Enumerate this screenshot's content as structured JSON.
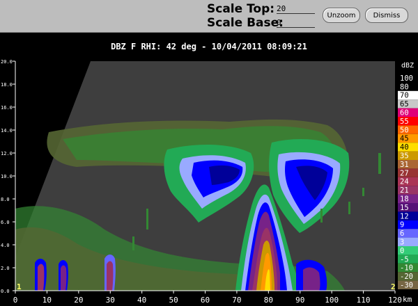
{
  "controls": {
    "scale_top_label": "Scale Top:",
    "scale_top_value": "20",
    "scale_base_label": "Scale Base:",
    "scale_base_value": "0",
    "unzoom_label": "Unzoom",
    "dismiss_label": "Dismiss"
  },
  "plot": {
    "title": "DBZ F  RHI: 42 deg  -  10/04/2011 08:09:21",
    "x_unit": "km",
    "x_ticks": [
      "0",
      "10",
      "20",
      "30",
      "40",
      "50",
      "60",
      "70",
      "80",
      "90",
      "100",
      "110",
      "120"
    ],
    "y_ticks": [
      "0.0",
      "2.0",
      "4.0",
      "6.0",
      "8.0",
      "10.0",
      "12.0",
      "14.0",
      "16.0",
      "18.0",
      "20.0"
    ],
    "corner_left": "1",
    "corner_right": "2"
  },
  "colorbar": {
    "unit": "dBZ",
    "entries": [
      {
        "label": "100",
        "color": "#000000"
      },
      {
        "label": "80",
        "color": "#000000"
      },
      {
        "label": "70",
        "color": "#ffffff"
      },
      {
        "label": "65",
        "color": "#c8c8c8"
      },
      {
        "label": "60",
        "color": "#e00078"
      },
      {
        "label": "55",
        "color": "#ff0000"
      },
      {
        "label": "50",
        "color": "#ff6600"
      },
      {
        "label": "45",
        "color": "#ff9900"
      },
      {
        "label": "40",
        "color": "#ffdd00"
      },
      {
        "label": "35",
        "color": "#cc9900"
      },
      {
        "label": "31",
        "color": "#aa6633"
      },
      {
        "label": "27",
        "color": "#993333"
      },
      {
        "label": "24",
        "color": "#aa3355"
      },
      {
        "label": "21",
        "color": "#993366"
      },
      {
        "label": "18",
        "color": "#772288"
      },
      {
        "label": "15",
        "color": "#551177"
      },
      {
        "label": "12",
        "color": "#000099"
      },
      {
        "label": "9",
        "color": "#0000ff"
      },
      {
        "label": "6",
        "color": "#6666ff"
      },
      {
        "label": "3",
        "color": "#99aaff"
      },
      {
        "label": "0",
        "color": "#33cc77"
      },
      {
        "label": "-5",
        "color": "#22aa55"
      },
      {
        "label": "-10",
        "color": "#338833"
      },
      {
        "label": "-20",
        "color": "#556633"
      },
      {
        "label": "-30",
        "color": "#776644"
      }
    ]
  }
}
